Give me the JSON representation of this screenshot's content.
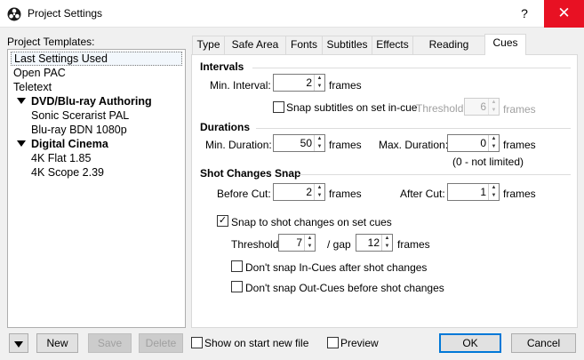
{
  "window": {
    "title": "Project Settings",
    "help_label": "?",
    "close_label": "✕"
  },
  "templates": {
    "label": "Project Templates:",
    "items": [
      {
        "label": "Last Settings Used"
      },
      {
        "label": "Open PAC"
      },
      {
        "label": "Teletext"
      },
      {
        "label": "DVD/Blu-ray Authoring"
      },
      {
        "label": "Sonic Scerarist PAL"
      },
      {
        "label": "Blu-ray BDN 1080p"
      },
      {
        "label": "Digital Cinema"
      },
      {
        "label": "4K Flat 1.85"
      },
      {
        "label": "4K Scope 2.39"
      }
    ]
  },
  "tabs": [
    {
      "label": "Type"
    },
    {
      "label": "Safe Area"
    },
    {
      "label": "Fonts"
    },
    {
      "label": "Subtitles"
    },
    {
      "label": "Effects"
    },
    {
      "label": "Reading Speed"
    },
    {
      "label": "Cues"
    }
  ],
  "cues": {
    "intervals": {
      "heading": "Intervals",
      "min_interval_label": "Min. Interval:",
      "min_interval_value": "2",
      "min_interval_unit": "frames",
      "snap_label": "Snap subtitles on set in-cue",
      "snap_checked": false,
      "threshold_label": "Threshold:",
      "threshold_value": "6",
      "threshold_unit": "frames"
    },
    "durations": {
      "heading": "Durations",
      "min_label": "Min. Duration:",
      "min_value": "50",
      "min_unit": "frames",
      "max_label": "Max. Duration:",
      "max_value": "0",
      "max_unit": "frames",
      "max_note": "(0 - not limited)"
    },
    "shot_changes": {
      "heading": "Shot Changes Snap",
      "before_label": "Before Cut:",
      "before_value": "2",
      "before_unit": "frames",
      "after_label": "After Cut:",
      "after_value": "1",
      "after_unit": "frames",
      "snap_label": "Snap to shot changes on set cues",
      "snap_checked": true,
      "threshold_label": "Threshold:",
      "threshold_value": "7",
      "gap_label": "/ gap",
      "gap_value": "12",
      "gap_unit": "frames",
      "no_in_label": "Don't snap In-Cues after shot changes",
      "no_out_label": "Don't snap Out-Cues before shot changes"
    }
  },
  "bottom": {
    "new_label": "New",
    "save_label": "Save",
    "delete_label": "Delete",
    "show_on_start_label": "Show on start new file",
    "preview_label": "Preview",
    "ok_label": "OK",
    "cancel_label": "Cancel"
  },
  "icons": {
    "arrow_up": "▲",
    "arrow_down": "▼",
    "check": "✓"
  },
  "colors": {
    "close_red": "#e81123",
    "accent_blue": "#0078d7"
  }
}
